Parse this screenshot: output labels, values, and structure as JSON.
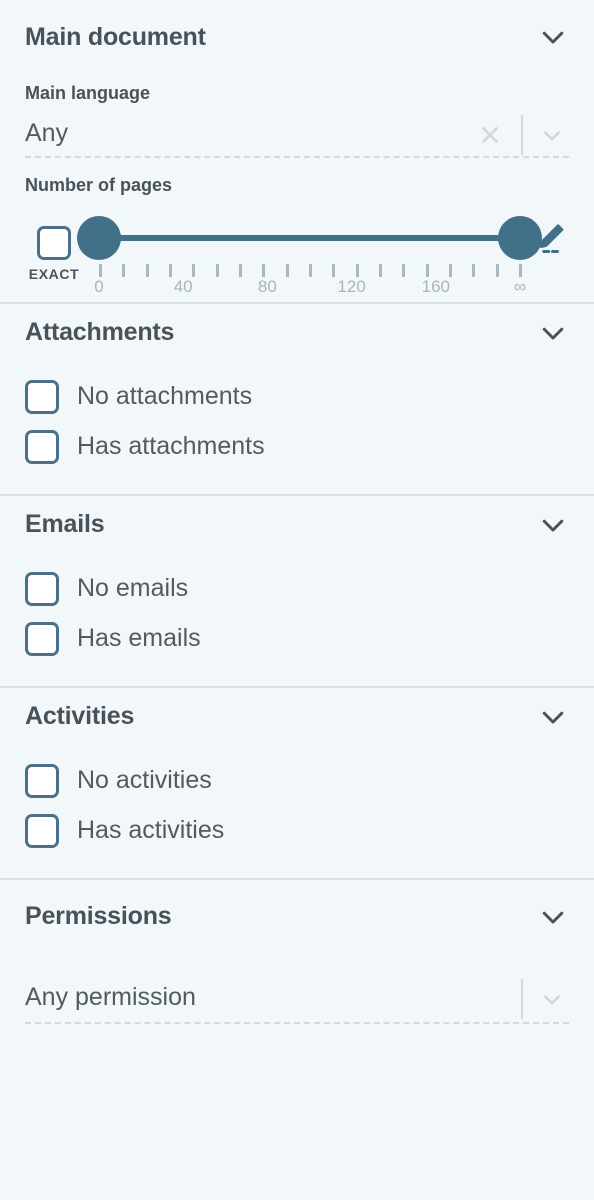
{
  "theme": {
    "background": "#f2f7fa",
    "accent": "#437089",
    "heading_color": "#49515b",
    "muted_color": "#a9b4bd",
    "divider_color": "#d7e0e6"
  },
  "sections": {
    "main_document": {
      "title": "Main document",
      "collapse_icon": "chevron-down-icon",
      "language_field": {
        "label": "Main language",
        "value": "Any",
        "placeholder": "Any",
        "clear_icon": "close-icon",
        "dropdown_icon": "chevron-down-icon"
      },
      "pages_field": {
        "label": "Number of pages",
        "exact_label": "EXACT",
        "exact_checked": false,
        "edit_icon": "pencil-icon",
        "slider": {
          "min_value": "0",
          "max_value": "∞",
          "tick_labels": [
            "0",
            "40",
            "80",
            "120",
            "160",
            "∞"
          ],
          "tick_count": 19,
          "selected_min": 0,
          "selected_max": 200
        }
      }
    },
    "attachments": {
      "title": "Attachments",
      "collapse_icon": "chevron-down-icon",
      "options": [
        {
          "label": "No attachments",
          "checked": false
        },
        {
          "label": "Has attachments",
          "checked": false
        }
      ]
    },
    "emails": {
      "title": "Emails",
      "collapse_icon": "chevron-down-icon",
      "options": [
        {
          "label": "No emails",
          "checked": false
        },
        {
          "label": "Has emails",
          "checked": false
        }
      ]
    },
    "activities": {
      "title": "Activities",
      "collapse_icon": "chevron-down-icon",
      "options": [
        {
          "label": "No activities",
          "checked": false
        },
        {
          "label": "Has activities",
          "checked": false
        }
      ]
    },
    "permissions": {
      "title": "Permissions",
      "collapse_icon": "chevron-down-icon",
      "permission_field": {
        "value": "Any permission",
        "dropdown_icon": "chevron-down-icon"
      }
    }
  }
}
